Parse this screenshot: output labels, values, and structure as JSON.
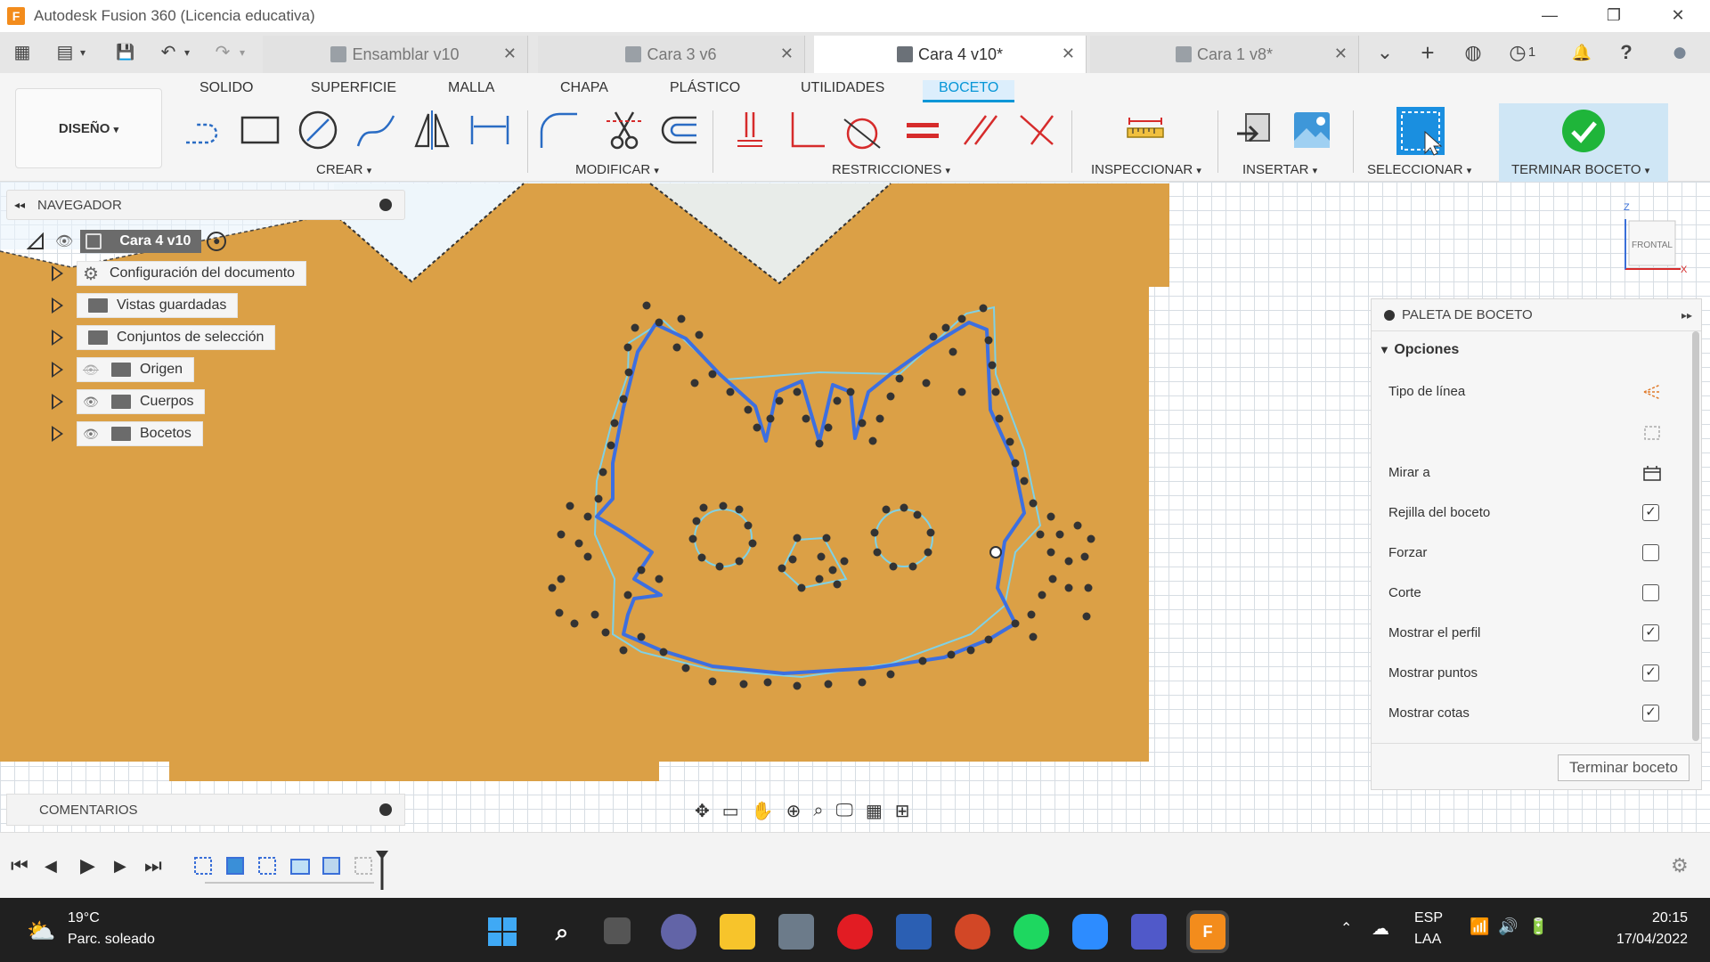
{
  "window": {
    "app_logo": "F",
    "title": "Autodesk Fusion 360 (Licencia educativa)",
    "controls": {
      "minimize": "—",
      "restore": "❐",
      "close": "✕"
    }
  },
  "quick_access": {
    "grid_icon": "▦",
    "file_icon": "▤",
    "save_icon": "💾",
    "undo_icon": "↶",
    "redo_icon": "↷",
    "dropdown": "▾"
  },
  "tabs": [
    {
      "label": "Ensamblar v10",
      "active": false
    },
    {
      "label": "Cara 3 v6",
      "active": false
    },
    {
      "label": "Cara 4 v10*",
      "active": true
    },
    {
      "label": "Cara 1 v8*",
      "active": false
    }
  ],
  "tab_close": "✕",
  "tabbar_right": {
    "overflow": "⌄",
    "new_tab": "+",
    "extensions": "◍",
    "jobs": "◷",
    "jobs_count": "1",
    "notifications": "🔔",
    "help": "?",
    "avatar": "●"
  },
  "ribbon": {
    "tabs": [
      "SOLIDO",
      "SUPERFICIE",
      "MALLA",
      "CHAPA",
      "PLÁSTICO",
      "UTILIDADES",
      "BOCETO"
    ],
    "active_tab": "BOCETO",
    "workspace": "DISEÑO",
    "groups": [
      "CREAR",
      "MODIFICAR",
      "RESTRICCIONES",
      "INSPECCIONAR",
      "INSERTAR",
      "SELECCIONAR",
      "TERMINAR BOCETO"
    ],
    "group_caret": "▾"
  },
  "navigator": {
    "title": "NAVEGADOR",
    "collapse_icon": "◂◂",
    "root": "Cara 4 v10",
    "items": [
      {
        "label": "Configuración del documento"
      },
      {
        "label": "Vistas guardadas"
      },
      {
        "label": "Conjuntos de selección"
      },
      {
        "label": "Origen"
      },
      {
        "label": "Cuerpos"
      },
      {
        "label": "Bocetos"
      }
    ]
  },
  "viewcube": {
    "label": "FRONTAL",
    "axis_z": "Z",
    "axis_x": "X"
  },
  "palette": {
    "title": "PALETA DE BOCETO",
    "expand_icon": "▸▸",
    "section": "Opciones",
    "rows": [
      {
        "label": "Tipo de línea",
        "control": "icon"
      },
      {
        "label": "",
        "control": "icon"
      },
      {
        "label": "Mirar a",
        "control": "icon"
      },
      {
        "label": "Rejilla del boceto",
        "control": "checkbox",
        "checked": true
      },
      {
        "label": "Forzar",
        "control": "checkbox",
        "checked": false
      },
      {
        "label": "Corte",
        "control": "checkbox",
        "checked": false
      },
      {
        "label": "Mostrar el perfil",
        "control": "checkbox",
        "checked": true
      },
      {
        "label": "Mostrar puntos",
        "control": "checkbox",
        "checked": true
      },
      {
        "label": "Mostrar cotas",
        "control": "checkbox",
        "checked": true
      }
    ],
    "finish_button": "Terminar boceto",
    "check_glyph": "✓"
  },
  "comments": {
    "title": "COMENTARIOS"
  },
  "timeline": {
    "first": "⏮",
    "prev": "◀",
    "play": "▶",
    "next": "▶",
    "last": "⏭",
    "settings": "⚙"
  },
  "taskbar": {
    "weather_temp": "19°C",
    "weather_desc": "Parc. soleado",
    "lang1": "ESP",
    "lang2": "LAA",
    "time": "20:15",
    "date": "17/04/2022"
  },
  "colors": {
    "accent": "#0696d7",
    "body_fill": "#dba046",
    "sketch_blue": "#3d6fe0",
    "profile_cyan": "#7fd1e6",
    "finish_green": "#1fb53a"
  }
}
